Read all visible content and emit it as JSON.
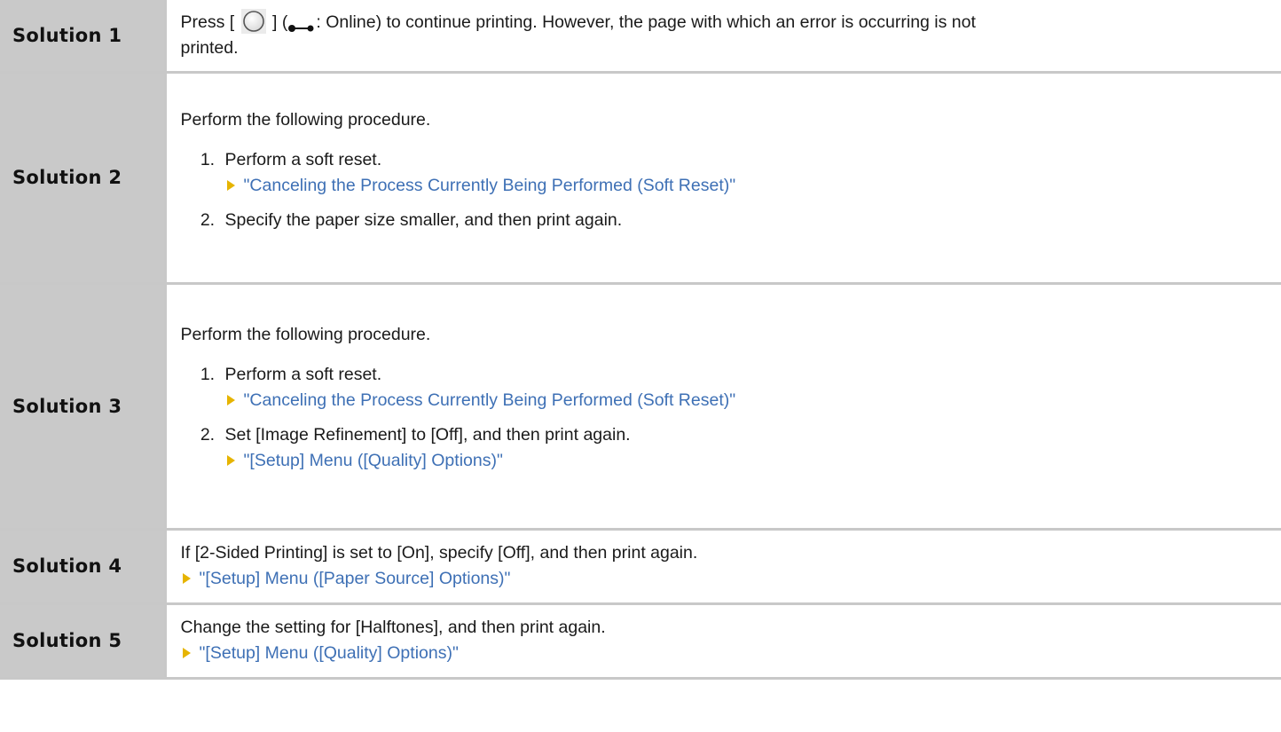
{
  "solutions": [
    {
      "label": "Solution 1",
      "text_press": "Press [",
      "text_bracket_close": "] (",
      "text_after_icon": ": Online) to continue printing. However, the page with which an error is occurring is not",
      "text_line2": "printed."
    },
    {
      "label": "Solution 2",
      "intro": "Perform the following procedure.",
      "steps": [
        {
          "text": "Perform a soft reset.",
          "link": "\"Canceling the Process Currently Being Performed (Soft Reset)\""
        },
        {
          "text": "Specify the paper size smaller, and then print again."
        }
      ]
    },
    {
      "label": "Solution 3",
      "intro": "Perform the following procedure.",
      "steps": [
        {
          "text": "Perform a soft reset.",
          "link": "\"Canceling the Process Currently Being Performed (Soft Reset)\""
        },
        {
          "text": "Set [Image Refinement] to [Off], and then print again.",
          "link": "\"[Setup] Menu ([Quality] Options)\""
        }
      ]
    },
    {
      "label": "Solution 4",
      "text": "If [2-Sided Printing] is set to [On], specify [Off], and then print again.",
      "link": "\"[Setup] Menu ([Paper Source] Options)\""
    },
    {
      "label": "Solution 5",
      "text": "Change the setting for [Halftones], and then print again.",
      "link": "\"[Setup] Menu ([Quality] Options)\""
    }
  ],
  "colors": {
    "label_bg": "#c9c9c9",
    "border": "#c8c8c8",
    "link": "#3e70b5",
    "arrow": "#e6b400"
  },
  "icons": [
    "stop-button-icon",
    "online-indicator-icon",
    "arrow-bullet-icon"
  ]
}
